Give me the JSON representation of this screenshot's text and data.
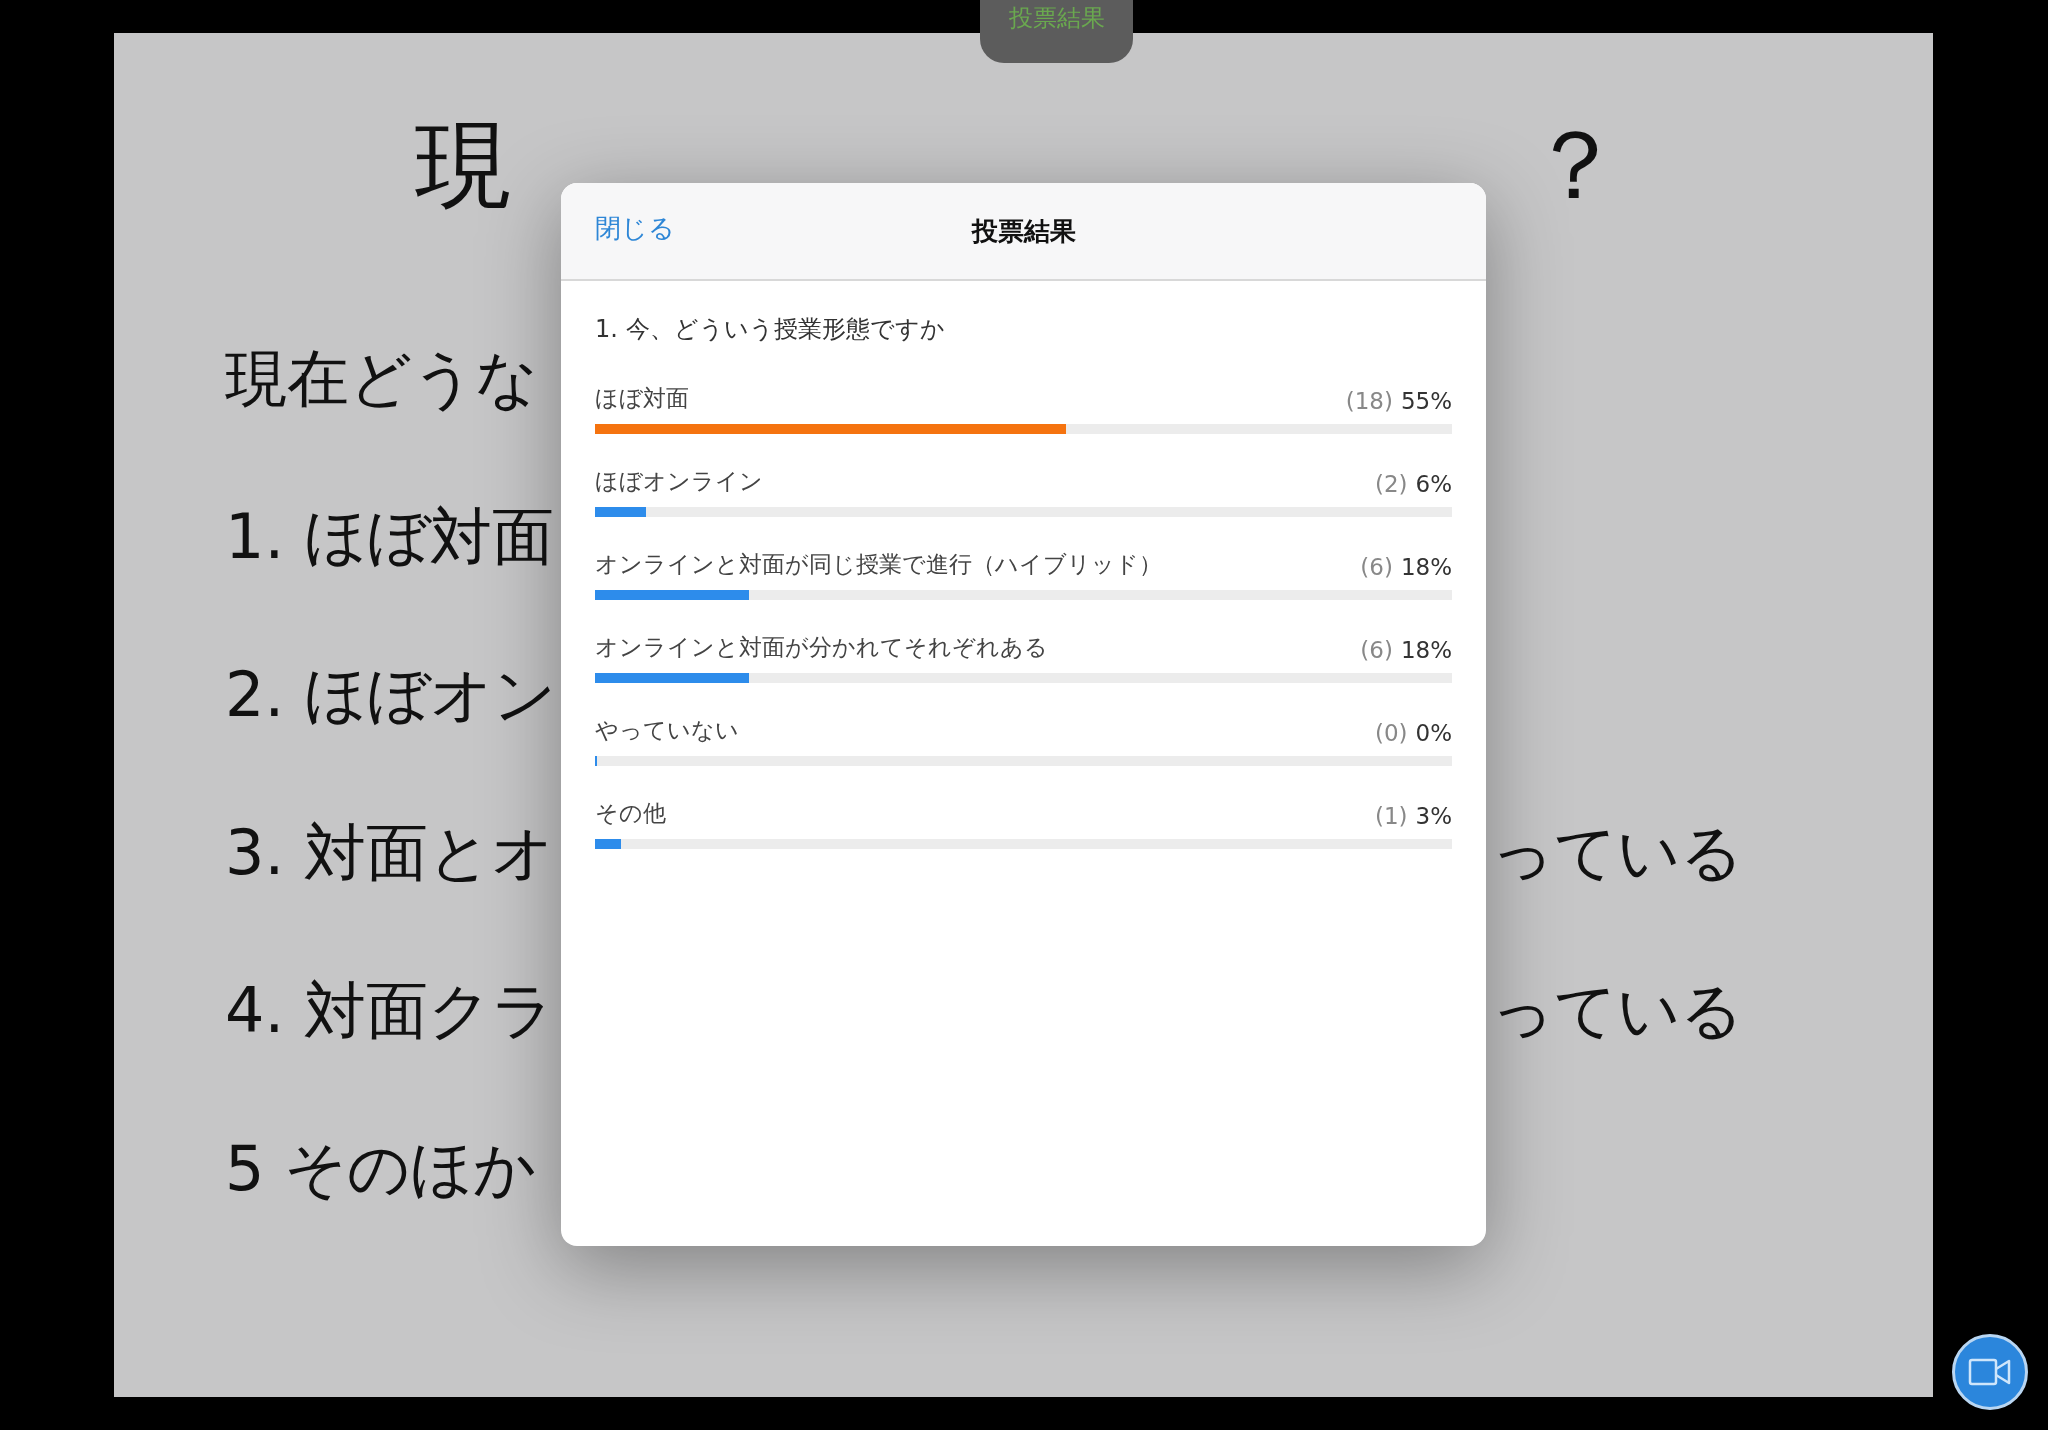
{
  "top_pill": {
    "label": "投票結果"
  },
  "slide": {
    "title_parts": [
      "現",
      "？"
    ],
    "lines": [
      {
        "left": "現在どうな"
      },
      {
        "left": "1.  ほぼ対面"
      },
      {
        "left": "2.  ほぼオン"
      },
      {
        "left": "3.  対面とオ",
        "right": "っている"
      },
      {
        "left": "4.  対面クラ",
        "right": "っている"
      },
      {
        "left": "5   そのほか"
      }
    ]
  },
  "dialog": {
    "close": "閉じる",
    "title": "投票結果",
    "question": "1. 今、どういう授業形態ですか",
    "options": [
      {
        "label": "ほぼ対面",
        "count": "(18)",
        "percent": "55%",
        "level": 0.55,
        "leading": true
      },
      {
        "label": "ほぼオンライン",
        "count": "(2)",
        "percent": "6%",
        "level": 0.06,
        "leading": false
      },
      {
        "label": "オンラインと対面が同じ授業で進行（ハイブリッド）",
        "count": "(6)",
        "percent": "18%",
        "level": 0.18,
        "leading": false
      },
      {
        "label": "オンラインと対面が分かれてそれぞれある",
        "count": "(6)",
        "percent": "18%",
        "level": 0.18,
        "leading": false
      },
      {
        "label": "やっていない",
        "count": "(0)",
        "percent": "0%",
        "level": 0,
        "leading": false
      },
      {
        "label": "その他",
        "count": "(1)",
        "percent": "3%",
        "level": 0.03,
        "leading": false
      }
    ]
  }
}
